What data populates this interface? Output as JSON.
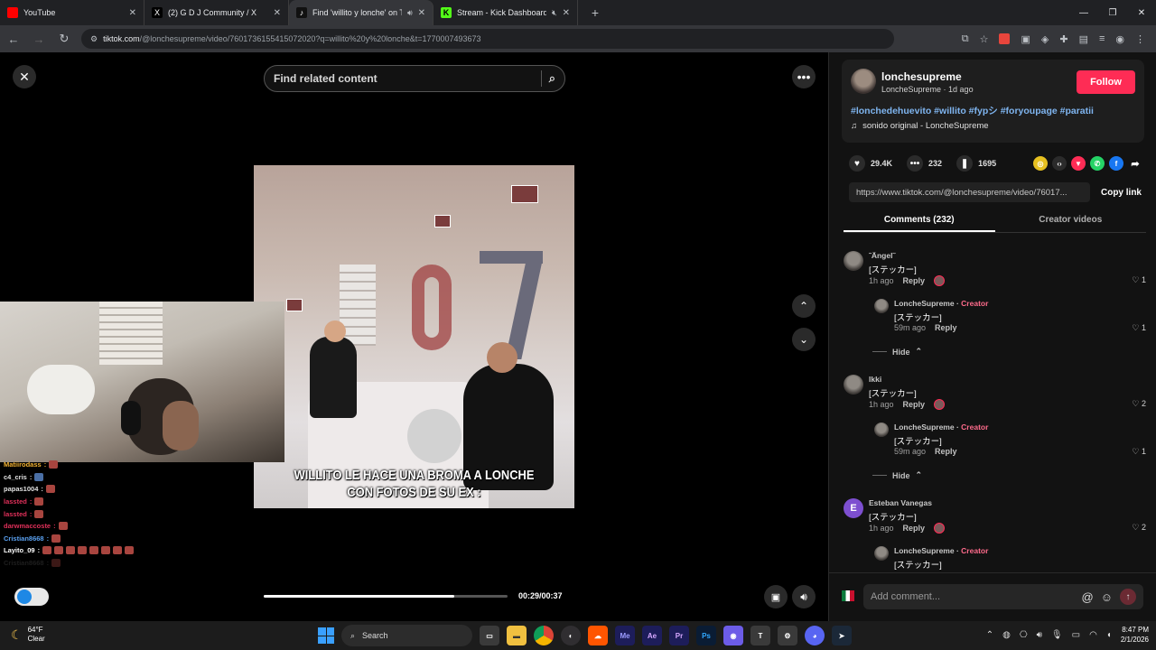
{
  "browser": {
    "tabs": [
      {
        "title": "YouTube",
        "favicon_color": "#ff0000",
        "active": false,
        "muted": false
      },
      {
        "title": "(2) G D J Community / X",
        "favicon_color": "#000000",
        "active": false,
        "muted": false
      },
      {
        "title": "Find 'willito y lonche' on Tik",
        "favicon_color": "#111111",
        "active": true,
        "muted": true
      },
      {
        "title": "Stream - Kick Dashboard",
        "favicon_color": "#53fc18",
        "active": false,
        "muted": true
      }
    ],
    "url_domain": "tiktok.com",
    "url_path": "/@lonchesupreme/video/7601736155415072020?q=willito%20y%20lonche&t=1770007493673"
  },
  "search": {
    "placeholder": "Find related content"
  },
  "video": {
    "caption_line1": "WILLITO LE HACE UNA BROMA A LONCHE",
    "caption_line2": "CON FOTOS DE SU EX :",
    "progress": 0.78,
    "timecode": "00:29/00:37"
  },
  "chat": [
    {
      "user": "Matiirodass",
      "color": "#f2b233",
      "emotes": 1
    },
    {
      "user": "c4_cris",
      "color": "#e0e0e0",
      "emotes": 1
    },
    {
      "user": "papas1004",
      "color": "#e0e0e0",
      "emotes": 1
    },
    {
      "user": "lassted",
      "color": "#e0305a",
      "emotes": 1
    },
    {
      "user": "lassted",
      "color": "#e0305a",
      "emotes": 1
    },
    {
      "user": "darwmaccoste",
      "color": "#e0305a",
      "emotes": 1
    },
    {
      "user": "Cristian8668",
      "color": "#5aa0f0",
      "emotes": 1
    },
    {
      "user": "Layito_09",
      "color": "#ffffff",
      "emotes": 8
    },
    {
      "user": "Cristian8668",
      "color": "#555555",
      "emotes": 1
    }
  ],
  "creator": {
    "username": "lonchesupreme",
    "display_and_time": "LoncheSupreme · 1d ago",
    "follow_label": "Follow",
    "hashtags": "#lonchedehuevito #willito #fypシ #foryoupage #paratii",
    "sound": "sonido original - LoncheSupreme"
  },
  "stats": {
    "likes": "29.4K",
    "comments": "232",
    "saves": "1695"
  },
  "share_link": "https://www.tiktok.com/@lonchesupreme/video/76017...",
  "copy_link_label": "Copy link",
  "tabs": {
    "comments": "Comments (232)",
    "creator_videos": "Creator videos"
  },
  "comments": [
    {
      "user": "˜Ängel˜",
      "text": "[ステッカー]",
      "time": "1h ago",
      "reply": "Reply",
      "likes": "1",
      "sub": {
        "user": "LoncheSupreme",
        "badge": "Creator",
        "text": "[ステッカー]",
        "time": "59m ago",
        "reply": "Reply",
        "likes": "1"
      }
    },
    {
      "user": "Ikki",
      "text": "[ステッカー]",
      "time": "1h ago",
      "reply": "Reply",
      "likes": "2",
      "sub": {
        "user": "LoncheSupreme",
        "badge": "Creator",
        "text": "[ステッカー]",
        "time": "59m ago",
        "reply": "Reply",
        "likes": "1"
      }
    },
    {
      "user": "Esteban Vanegas",
      "avatar_letter": "E",
      "text": "[ステッカー]",
      "time": "1h ago",
      "reply": "Reply",
      "likes": "2",
      "sub": {
        "user": "LoncheSupreme",
        "badge": "Creator",
        "text": "[ステッカー]"
      }
    }
  ],
  "hide_label": "Hide",
  "add_comment": {
    "placeholder": "Add comment..."
  },
  "taskbar": {
    "temp": "64°F",
    "condition": "Clear",
    "search_label": "Search",
    "time": "8:47 PM",
    "date": "2/1/2026"
  }
}
